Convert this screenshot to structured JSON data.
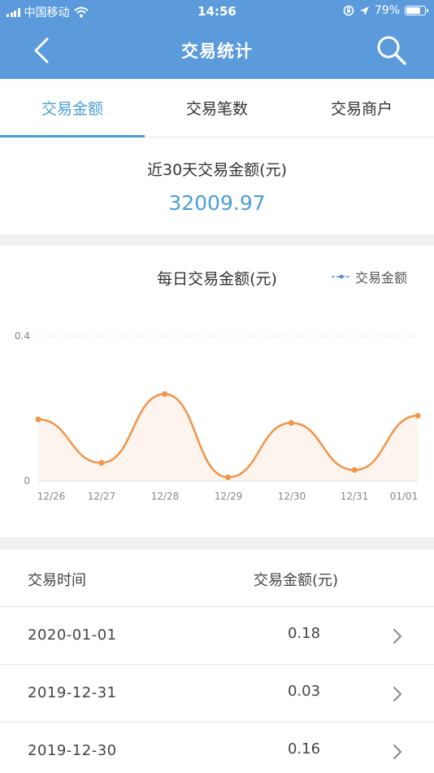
{
  "status_bar": {
    "carrier": "中国移动",
    "time": "14:56",
    "battery": "79%",
    "battery_level": 0.79
  },
  "nav": {
    "title": "交易统计",
    "back_icon": "chevron-left-icon",
    "search_icon": "search-icon"
  },
  "tabs": [
    {
      "label": "交易金额",
      "active": true
    },
    {
      "label": "交易笔数",
      "active": false
    },
    {
      "label": "交易商户",
      "active": false
    }
  ],
  "summary": {
    "label": "近30天交易金额(元)",
    "value": "32009.97"
  },
  "chart": {
    "title": "每日交易金额(元)",
    "legend": "交易金额",
    "color": "#f0944a"
  },
  "chart_data": {
    "type": "area",
    "title": "每日交易金额(元)",
    "categories": [
      "12/26",
      "12/27",
      "12/28",
      "12/29",
      "12/30",
      "12/31",
      "01/01"
    ],
    "series": [
      {
        "name": "交易金额",
        "values": [
          0.17,
          0.05,
          0.24,
          0.01,
          0.16,
          0.03,
          0.18
        ]
      }
    ],
    "yticks": [
      "0",
      "0.4"
    ],
    "ylim": [
      0,
      0.4
    ],
    "grid": true,
    "legend_position": "top-right"
  },
  "table": {
    "headers": {
      "time": "交易时间",
      "amount": "交易金额(元)"
    },
    "rows": [
      {
        "date": "2020-01-01",
        "amount": "0.18"
      },
      {
        "date": "2019-12-31",
        "amount": "0.03"
      },
      {
        "date": "2019-12-30",
        "amount": "0.16"
      }
    ]
  },
  "colors": {
    "nav_bg": "#5b9bdc",
    "accent": "#4a9fd8",
    "line": "#f0944a"
  }
}
